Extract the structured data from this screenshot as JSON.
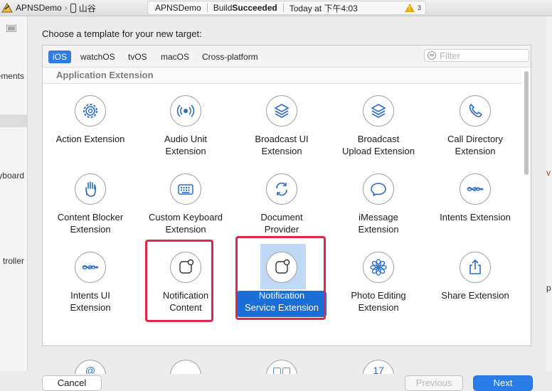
{
  "toolbar": {
    "project": "APNSDemo",
    "device": "山谷",
    "status_project": "APNSDemo",
    "build_prefix": "Build ",
    "build_status": "Succeeded",
    "timestamp": "Today at 下午4:03",
    "warning_count": "3"
  },
  "background": {
    "left_clips": [
      "ements",
      "ryboard",
      "troller"
    ],
    "right_clips": [
      "v",
      "p"
    ]
  },
  "sheet": {
    "title": "Choose a template for your new target:",
    "tabs": [
      "iOS",
      "watchOS",
      "tvOS",
      "macOS",
      "Cross-platform"
    ],
    "active_tab": "iOS",
    "filter_placeholder": "Filter",
    "section": "Application Extension",
    "templates": {
      "action": "Action Extension",
      "audio_unit_1": "Audio Unit",
      "audio_unit_2": "Extension",
      "broadcast_ui_1": "Broadcast UI",
      "broadcast_ui_2": "Extension",
      "broadcast_upload_1": "Broadcast",
      "broadcast_upload_2": "Upload Extension",
      "call_directory_1": "Call Directory",
      "call_directory_2": "Extension",
      "content_blocker_1": "Content Blocker",
      "content_blocker_2": "Extension",
      "custom_keyboard_1": "Custom Keyboard",
      "custom_keyboard_2": "Extension",
      "document_provider_1": "Document",
      "document_provider_2": "Provider",
      "imessage_1": "iMessage",
      "imessage_2": "Extension",
      "intents": "Intents Extension",
      "intents_ui_1": "Intents UI",
      "intents_ui_2": "Extension",
      "notification_content_1": "Notification",
      "notification_content_2": "Content",
      "notification_service_1": "Notification",
      "notification_service_2": "Service Extension",
      "photo_editing_1": "Photo Editing",
      "photo_editing_2": "Extension",
      "share": "Share Extension"
    },
    "peek_calendar_day": "17",
    "buttons": {
      "cancel": "Cancel",
      "previous": "Previous",
      "next": "Next"
    }
  },
  "colors": {
    "accent": "#2f7ce4",
    "selection": "#1a6ed8",
    "highlight_box": "#e0264b"
  }
}
